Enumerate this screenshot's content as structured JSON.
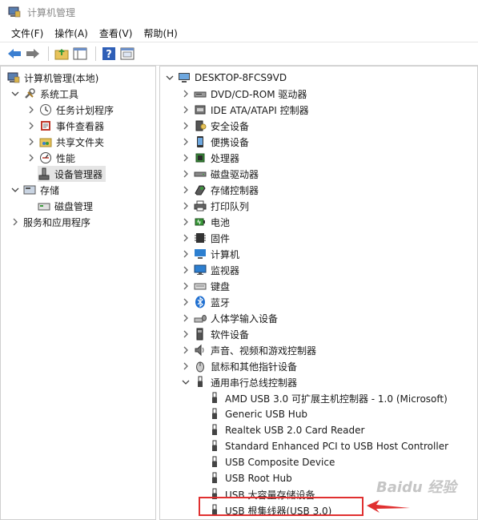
{
  "window": {
    "title": "计算机管理"
  },
  "menu": [
    "文件(F)",
    "操作(A)",
    "查看(V)",
    "帮助(H)"
  ],
  "left_tree": {
    "root": "计算机管理(本地)",
    "system_tools": "系统工具",
    "items": [
      "任务计划程序",
      "事件查看器",
      "共享文件夹",
      "性能",
      "设备管理器"
    ],
    "storage": "存储",
    "disk_management": "磁盘管理",
    "services": "服务和应用程序"
  },
  "right_tree": {
    "computer": "DESKTOP-8FCS9VD",
    "categories": [
      "DVD/CD-ROM 驱动器",
      "IDE ATA/ATAPI 控制器",
      "安全设备",
      "便携设备",
      "处理器",
      "磁盘驱动器",
      "存储控制器",
      "打印队列",
      "电池",
      "固件",
      "计算机",
      "监视器",
      "键盘",
      "蓝牙",
      "人体学输入设备",
      "软件设备",
      "声音、视频和游戏控制器",
      "鼠标和其他指针设备",
      "通用串行总线控制器"
    ],
    "usb_devices": [
      "AMD USB 3.0 可扩展主机控制器 - 1.0 (Microsoft)",
      "Generic USB Hub",
      "Realtek USB 2.0 Card Reader",
      "Standard Enhanced PCI to USB Host Controller",
      "USB Composite Device",
      "USB Root Hub",
      "USB 大容量存储设备",
      "USB 根集线器(USB 3.0)"
    ]
  },
  "watermark": "Baidu 经验"
}
